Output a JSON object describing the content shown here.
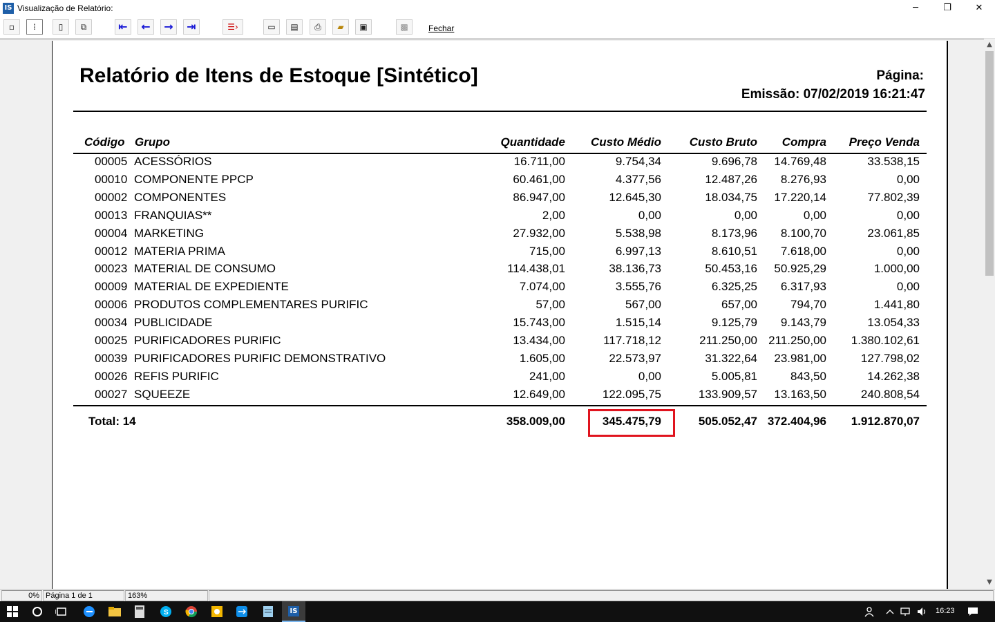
{
  "window": {
    "icon_text": "IS",
    "title": "Visualização de Relatório:",
    "minimize": "─",
    "maximize": "❐",
    "close": "✕"
  },
  "toolbar": {
    "close_label": "Fechar"
  },
  "report": {
    "title": "Relatório de Itens de Estoque [Sintético]",
    "page_label": "Página:",
    "emission": "Emissão: 07/02/2019 16:21:47",
    "headers": {
      "codigo": "Código",
      "grupo": "Grupo",
      "quantidade": "Quantidade",
      "custo_medio": "Custo Médio",
      "custo_bruto": "Custo Bruto",
      "compra": "Compra",
      "preco_venda": "Preço Venda"
    },
    "rows": [
      {
        "codigo": "00005",
        "grupo": "ACESSÓRIOS",
        "quantidade": "16.711,00",
        "custo_medio": "9.754,34",
        "custo_bruto": "9.696,78",
        "compra": "14.769,48",
        "preco_venda": "33.538,15"
      },
      {
        "codigo": "00010",
        "grupo": "COMPONENTE PPCP",
        "quantidade": "60.461,00",
        "custo_medio": "4.377,56",
        "custo_bruto": "12.487,26",
        "compra": "8.276,93",
        "preco_venda": "0,00"
      },
      {
        "codigo": "00002",
        "grupo": "COMPONENTES",
        "quantidade": "86.947,00",
        "custo_medio": "12.645,30",
        "custo_bruto": "18.034,75",
        "compra": "17.220,14",
        "preco_venda": "77.802,39"
      },
      {
        "codigo": "00013",
        "grupo": "FRANQUIAS**",
        "quantidade": "2,00",
        "custo_medio": "0,00",
        "custo_bruto": "0,00",
        "compra": "0,00",
        "preco_venda": "0,00"
      },
      {
        "codigo": "00004",
        "grupo": "MARKETING",
        "quantidade": "27.932,00",
        "custo_medio": "5.538,98",
        "custo_bruto": "8.173,96",
        "compra": "8.100,70",
        "preco_venda": "23.061,85"
      },
      {
        "codigo": "00012",
        "grupo": "MATERIA PRIMA",
        "quantidade": "715,00",
        "custo_medio": "6.997,13",
        "custo_bruto": "8.610,51",
        "compra": "7.618,00",
        "preco_venda": "0,00"
      },
      {
        "codigo": "00023",
        "grupo": "MATERIAL DE CONSUMO",
        "quantidade": "114.438,01",
        "custo_medio": "38.136,73",
        "custo_bruto": "50.453,16",
        "compra": "50.925,29",
        "preco_venda": "1.000,00"
      },
      {
        "codigo": "00009",
        "grupo": "MATERIAL DE EXPEDIENTE",
        "quantidade": "7.074,00",
        "custo_medio": "3.555,76",
        "custo_bruto": "6.325,25",
        "compra": "6.317,93",
        "preco_venda": "0,00"
      },
      {
        "codigo": "00006",
        "grupo": "PRODUTOS COMPLEMENTARES PURIFIC",
        "quantidade": "57,00",
        "custo_medio": "567,00",
        "custo_bruto": "657,00",
        "compra": "794,70",
        "preco_venda": "1.441,80"
      },
      {
        "codigo": "00034",
        "grupo": "PUBLICIDADE",
        "quantidade": "15.743,00",
        "custo_medio": "1.515,14",
        "custo_bruto": "9.125,79",
        "compra": "9.143,79",
        "preco_venda": "13.054,33"
      },
      {
        "codigo": "00025",
        "grupo": "PURIFICADORES PURIFIC",
        "quantidade": "13.434,00",
        "custo_medio": "117.718,12",
        "custo_bruto": "211.250,00",
        "compra": "211.250,00",
        "preco_venda": "1.380.102,61"
      },
      {
        "codigo": "00039",
        "grupo": "PURIFICADORES PURIFIC DEMONSTRATIVO",
        "quantidade": "1.605,00",
        "custo_medio": "22.573,97",
        "custo_bruto": "31.322,64",
        "compra": "23.981,00",
        "preco_venda": "127.798,02"
      },
      {
        "codigo": "00026",
        "grupo": "REFIS PURIFIC",
        "quantidade": "241,00",
        "custo_medio": "0,00",
        "custo_bruto": "5.005,81",
        "compra": "843,50",
        "preco_venda": "14.262,38"
      },
      {
        "codigo": "00027",
        "grupo": "SQUEEZE",
        "quantidade": "12.649,00",
        "custo_medio": "122.095,75",
        "custo_bruto": "133.909,57",
        "compra": "13.163,50",
        "preco_venda": "240.808,54"
      }
    ],
    "total": {
      "label": "Total: 14",
      "quantidade": "358.009,00",
      "custo_medio": "345.475,79",
      "custo_bruto": "505.052,47",
      "compra": "372.404,96",
      "preco_venda": "1.912.870,07"
    }
  },
  "statusbar": {
    "progress": "0%",
    "page": "Página 1 de 1",
    "zoom": "163%"
  },
  "taskbar": {
    "time": "16:23",
    "app_label": "IS"
  }
}
